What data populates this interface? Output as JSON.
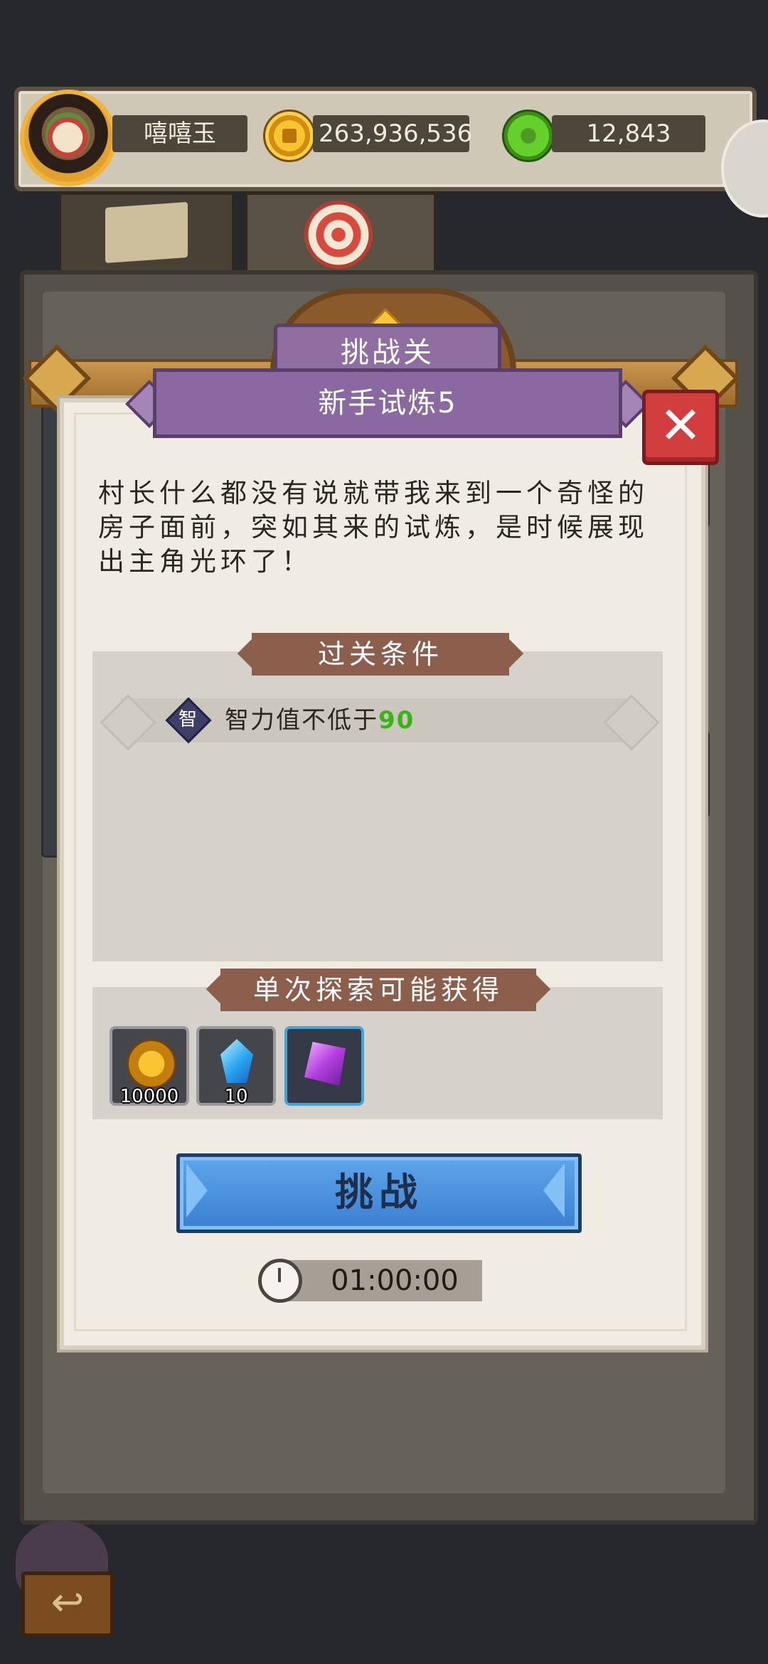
{
  "player": {
    "name": "嘻嘻玉"
  },
  "currencies": {
    "gold": "263,936,536",
    "jade": "12,843"
  },
  "dialog": {
    "subtitle": "挑战关",
    "title": "新手试炼5",
    "description": "村长什么都没有说就带我来到一个奇怪的房子面前，突如其来的试炼，是时候展现出主角光环了！",
    "conditions_title": "过关条件",
    "condition": {
      "badge": "智",
      "text": "智力值不低于",
      "value": "90"
    },
    "rewards_title": "单次探索可能获得",
    "rewards": [
      {
        "icon": "gold-coins-icon",
        "qty": "10000"
      },
      {
        "icon": "blue-crystal-icon",
        "qty": "10"
      },
      {
        "icon": "purple-gem-icon",
        "qty": ""
      }
    ],
    "challenge_label": "挑战",
    "timer": "01:00:00"
  },
  "return_icon_glyph": "↩",
  "close_glyph": "✕"
}
